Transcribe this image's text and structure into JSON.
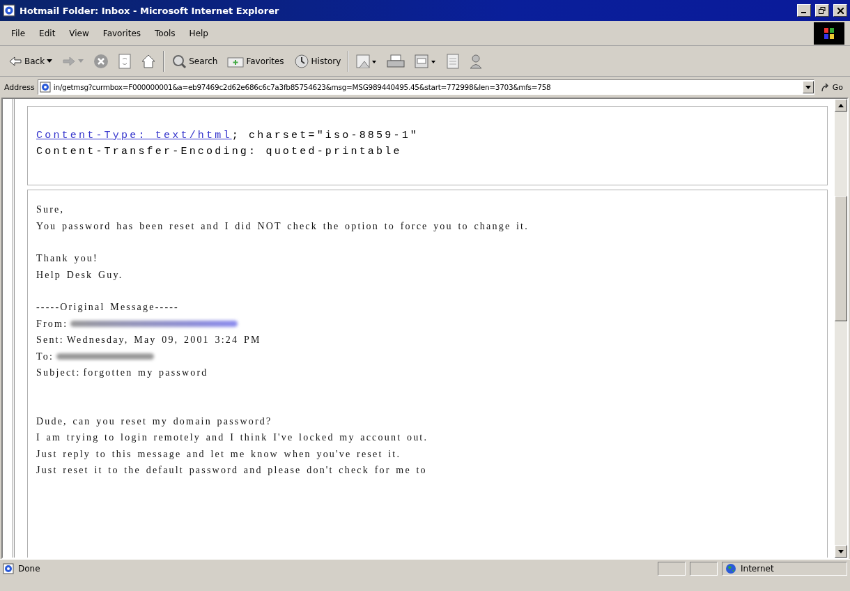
{
  "window": {
    "title": "Hotmail Folder: Inbox - Microsoft Internet Explorer"
  },
  "menu": [
    "File",
    "Edit",
    "View",
    "Favorites",
    "Tools",
    "Help"
  ],
  "toolbar": [
    {
      "kind": "back",
      "label": "Back"
    },
    {
      "kind": "forward"
    },
    {
      "kind": "stop"
    },
    {
      "kind": "refresh"
    },
    {
      "kind": "home"
    },
    {
      "kind": "separator"
    },
    {
      "kind": "search",
      "label": "Search"
    },
    {
      "kind": "favorites",
      "label": "Favorites"
    },
    {
      "kind": "history",
      "label": "History"
    },
    {
      "kind": "separator"
    },
    {
      "kind": "mail"
    },
    {
      "kind": "print"
    },
    {
      "kind": "edit"
    },
    {
      "kind": "discuss"
    },
    {
      "kind": "messenger"
    }
  ],
  "address": {
    "label": "Address",
    "value": "in/getmsg?curmbox=F000000001&a=eb97469c2d62e686c6c7a3fb85754623&msg=MSG989440495.45&start=772998&len=3703&mfs=758",
    "go": "Go"
  },
  "mime_header": {
    "link": "Content-Type: text/html",
    "rest": "; charset=\"iso-8859-1\"",
    "line2": "Content-Transfer-Encoding: quoted-printable"
  },
  "reply": [
    [
      "Sure,",
      "You password has been reset and I did NOT check the option to force you to change it."
    ],
    [
      "Thank you!",
      "Help Desk Guy."
    ]
  ],
  "original": {
    "divider": "-----Original Message-----",
    "fields": [
      {
        "label": "From:",
        "kind": "redacted_link"
      },
      {
        "label": "Sent:",
        "kind": "text",
        "value": "Wednesday, May 09, 2001 3:24 PM"
      },
      {
        "label": "To:",
        "kind": "redacted"
      },
      {
        "label": "Subject:",
        "kind": "text",
        "value": "forgotten my password"
      }
    ]
  },
  "message": [
    "Dude, can you reset my domain password?",
    "I am trying to login remotely and I think I've locked my account out.",
    "Just reply to this message and let me know when you've reset it.",
    "Just reset it to the default password and please don't check for me to"
  ],
  "status_bar": {
    "text": "Done",
    "zone": "Internet"
  }
}
